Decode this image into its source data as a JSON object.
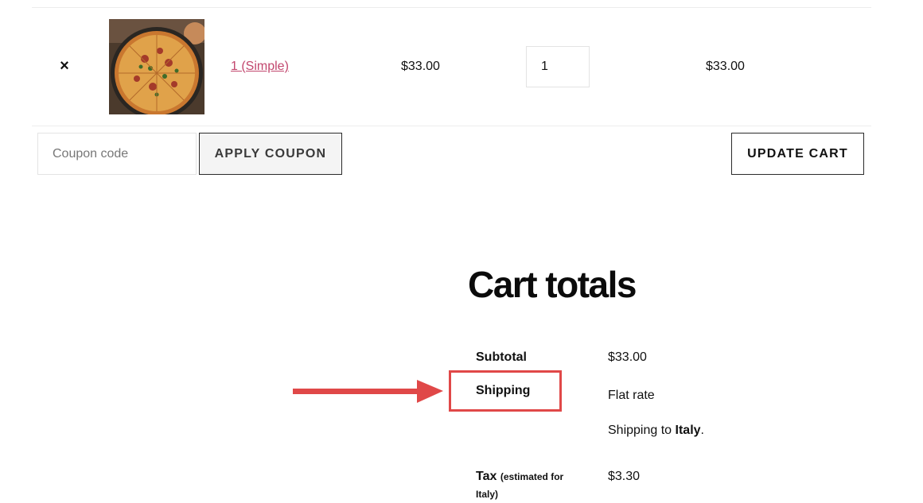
{
  "cart_row": {
    "remove_symbol": "×",
    "product_name": "1 (Simple)",
    "price": "$33.00",
    "quantity": "1",
    "subtotal": "$33.00"
  },
  "coupon": {
    "placeholder": "Coupon code",
    "apply_label": "APPLY COUPON"
  },
  "update_label": "UPDATE CART",
  "totals": {
    "title": "Cart totals",
    "subtotal_label": "Subtotal",
    "subtotal_value": "$33.00",
    "shipping_label": "Shipping",
    "shipping_method": "Flat rate",
    "shipping_to_prefix": "Shipping to ",
    "shipping_country": "Italy",
    "shipping_to_suffix": ".",
    "tax_label": "Tax",
    "tax_note_line1": "(estimated for",
    "tax_note_line2": "Italy)",
    "tax_value": "$3.30"
  },
  "colors": {
    "link": "#c2476e",
    "annotation": "#e04848"
  },
  "icons": {
    "remove": "close-icon",
    "product_image": "pizza-thumbnail",
    "annotation_arrow": "arrow-right-icon"
  }
}
